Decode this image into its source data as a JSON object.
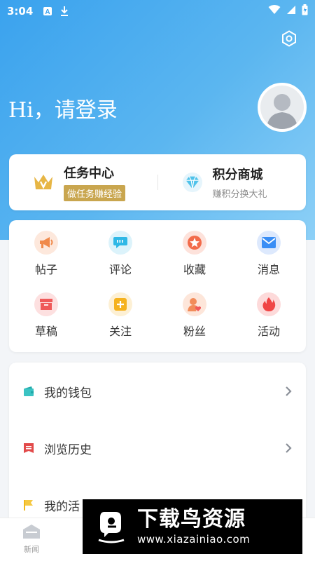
{
  "status_bar": {
    "time": "3:04"
  },
  "header": {
    "greeting": "Hi，请登录"
  },
  "top_card": {
    "task": {
      "title": "任务中心",
      "subtitle": "做任务赚经验"
    },
    "mall": {
      "title": "积分商城",
      "subtitle": "赚积分换大礼"
    }
  },
  "grid": [
    {
      "label": "帖子",
      "icon": "megaphone-icon",
      "color": "#f08a4b"
    },
    {
      "label": "评论",
      "icon": "comment-icon",
      "color": "#2fb8e6"
    },
    {
      "label": "收藏",
      "icon": "star-icon",
      "color": "#f26b4a"
    },
    {
      "label": "消息",
      "icon": "mail-icon",
      "color": "#3a8ef5"
    },
    {
      "label": "草稿",
      "icon": "drafts-box-icon",
      "color": "#ef5a5a"
    },
    {
      "label": "关注",
      "icon": "plus-square-icon",
      "color": "#f5b21e"
    },
    {
      "label": "粉丝",
      "icon": "user-heart-icon",
      "color": "#f28c5a"
    },
    {
      "label": "活动",
      "icon": "flame-icon",
      "color": "#f04545"
    }
  ],
  "list": [
    {
      "label": "我的钱包",
      "icon": "wallet-icon"
    },
    {
      "label": "浏览历史",
      "icon": "history-icon"
    },
    {
      "label": "我的活",
      "icon": "flag-icon"
    }
  ],
  "tabbar": {
    "news_label": "新闻"
  },
  "watermark": {
    "title": "下载鸟资源",
    "url": "www.xiazainiao.com"
  }
}
